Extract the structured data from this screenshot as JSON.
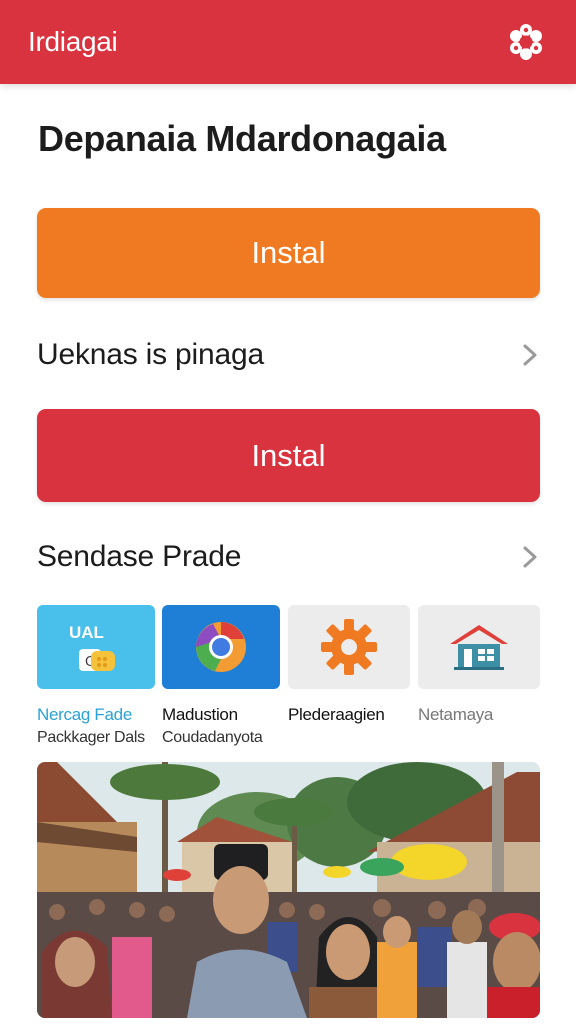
{
  "header": {
    "title": "Irdiagai",
    "settings_icon": "settings-flower-icon"
  },
  "main": {
    "title": "Depanaia Mdardonagaia",
    "primary_button": {
      "label": "Instal",
      "color": "#f07a21"
    },
    "row1": {
      "label": "Ueknas is pinaga",
      "icon": "chevron-right-icon"
    },
    "secondary_button": {
      "label": "Instal",
      "color": "#d8333f"
    },
    "row2": {
      "label": "Sendase Prade",
      "icon": "chevron-right-icon"
    },
    "tiles": [
      {
        "badge": "UAL",
        "title": "Nercag Fade",
        "subtitle": "Packkager Dals",
        "icon": "wallet-card-icon",
        "title_color": "#2ba2d6"
      },
      {
        "title": "Madustion",
        "subtitle": "Coudadanyota",
        "icon": "browser-circle-icon"
      },
      {
        "title": "Plederaagien",
        "subtitle": "",
        "icon": "gear-icon"
      },
      {
        "title": "Netamaya",
        "subtitle": "",
        "icon": "house-icon"
      }
    ],
    "photo": {
      "description_icon": "community-photo"
    }
  },
  "colors": {
    "header": "#d8333f",
    "orange": "#f07a21",
    "red": "#d8333f"
  }
}
